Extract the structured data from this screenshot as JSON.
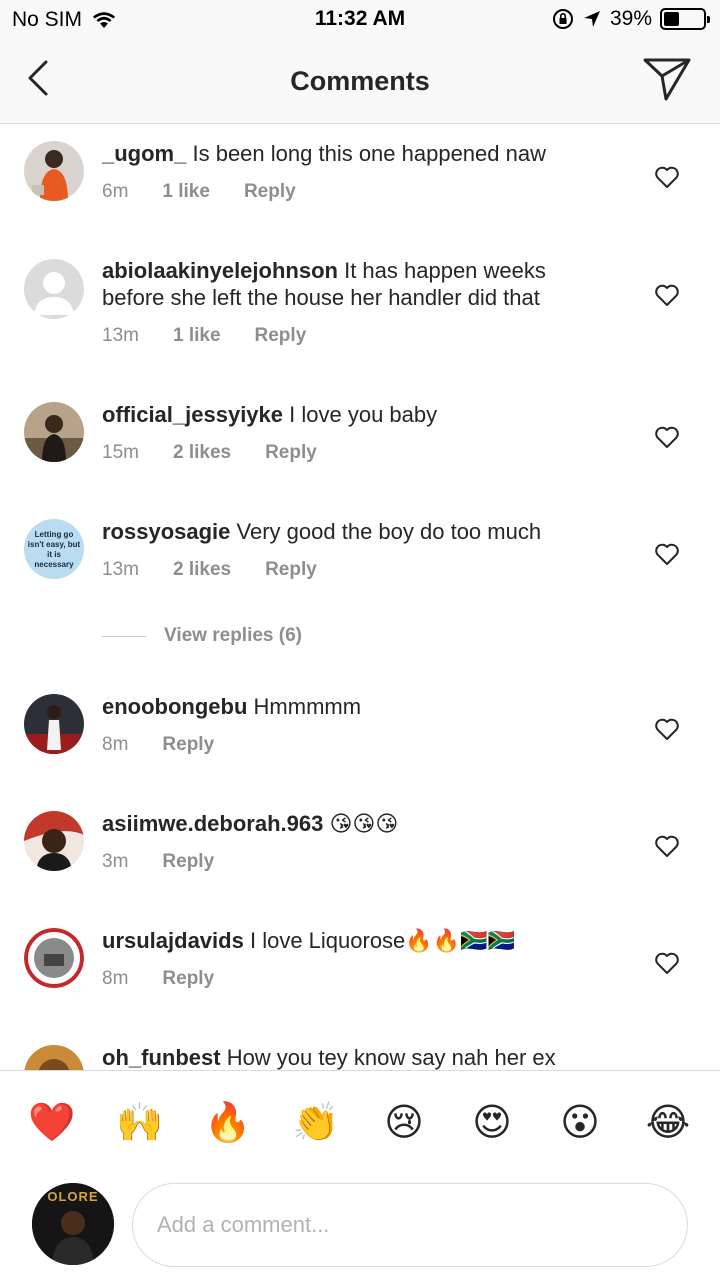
{
  "status_bar": {
    "carrier": "No SIM",
    "time": "11:32 AM",
    "battery": "39%",
    "battery_level": 0.39
  },
  "nav": {
    "title": "Comments",
    "back_icon": "chevron-left-icon",
    "send_icon": "paper-plane-icon"
  },
  "comments": [
    {
      "username": "_ugom_",
      "text": "Is been long this one happened naw",
      "time": "6m",
      "likes": "1 like",
      "reply": "Reply"
    },
    {
      "username": "abiolaakinyelejohnson",
      "text": "It has happen weeks before she left the house her handler did that",
      "time": "13m",
      "likes": "1 like",
      "reply": "Reply"
    },
    {
      "username": "official_jessyiyke",
      "text": "I love you baby",
      "time": "15m",
      "likes": "2 likes",
      "reply": "Reply"
    },
    {
      "username": "rossyosagie",
      "text": "Very good the boy do too much",
      "time": "13m",
      "likes": "2 likes",
      "reply": "Reply",
      "avatar_text": "Letting go isn't easy, but it is necessary"
    },
    {
      "username": "enoobongebu",
      "text": "Hmmmmm",
      "time": "8m",
      "reply": "Reply"
    },
    {
      "username": "asiimwe.deborah.963",
      "text": "😘😘😘",
      "time": "3m",
      "reply": "Reply"
    },
    {
      "username": "ursulajdavids",
      "text": "I love Liquorose🔥🔥🇿🇦🇿🇦",
      "time": "8m",
      "reply": "Reply"
    },
    {
      "username": "oh_funbest",
      "text": "How you tey know say nah her ex"
    }
  ],
  "view_replies": "View replies (6)",
  "emojis": [
    "❤️",
    "🙌",
    "🔥",
    "👏",
    "😢",
    "😍",
    "😮",
    "😂"
  ],
  "composer": {
    "placeholder": "Add a comment...",
    "avatar_text": "OLORE"
  }
}
